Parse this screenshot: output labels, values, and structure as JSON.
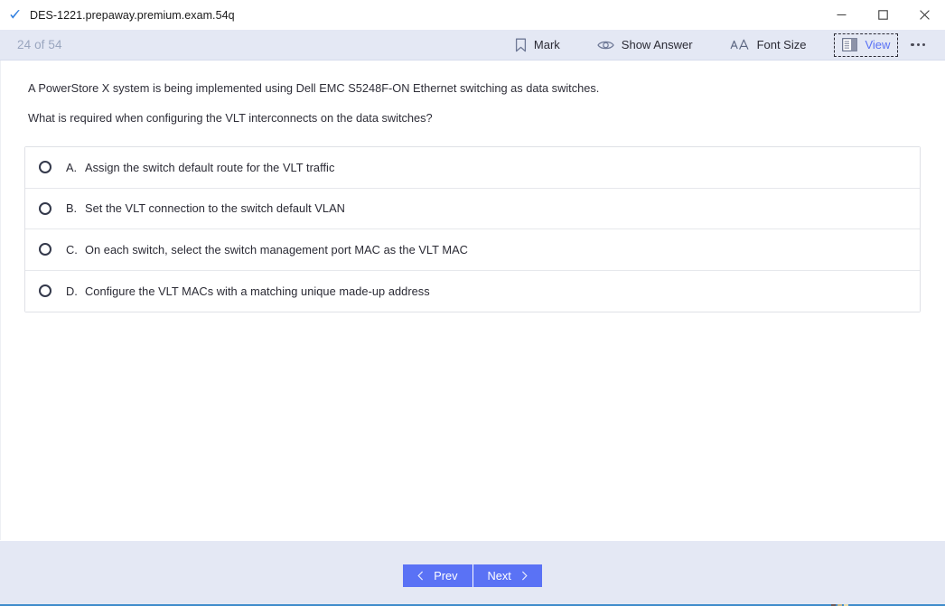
{
  "window": {
    "title": "DES-1221.prepaway.premium.exam.54q",
    "app_icon": "blue-checkmark-icon",
    "controls": {
      "minimize": "minimize-icon",
      "maximize": "maximize-icon",
      "close": "close-icon"
    }
  },
  "toolbar": {
    "counter": "24 of 54",
    "buttons": [
      {
        "label": "Mark",
        "icon": "bookmark-icon",
        "focused": false
      },
      {
        "label": "Show Answer",
        "icon": "eye-icon",
        "focused": false
      },
      {
        "label": "Font Size",
        "icon": "font-size-icon",
        "focused": false
      },
      {
        "label": "View",
        "icon": "view-layout-icon",
        "focused": true
      }
    ],
    "overflow": "more-options-icon"
  },
  "question": {
    "stem": "A PowerStore X system is being implemented using Dell EMC S5248F-ON Ethernet switching as data switches.",
    "prompt": "What is required when configuring the VLT interconnects on the data switches?",
    "options": [
      {
        "letter": "A.",
        "text": "Assign the switch default route for the VLT traffic",
        "selected": false
      },
      {
        "letter": "B.",
        "text": "Set the VLT connection to the switch default VLAN",
        "selected": false
      },
      {
        "letter": "C.",
        "text": "On each switch, select the switch management port MAC as the VLT MAC",
        "selected": false
      },
      {
        "letter": "D.",
        "text": "Configure the VLT MACs with a matching unique made-up address",
        "selected": false
      }
    ]
  },
  "footer": {
    "prev_label": "Prev",
    "next_label": "Next",
    "prev_icon": "chevron-left-icon",
    "next_icon": "chevron-right-icon"
  },
  "colors": {
    "accent_blue": "#5a72f5",
    "toolbar_bg": "#e4e8f4",
    "counter_text": "#9aa6bf",
    "bottom_line": "#3f8ccb"
  }
}
